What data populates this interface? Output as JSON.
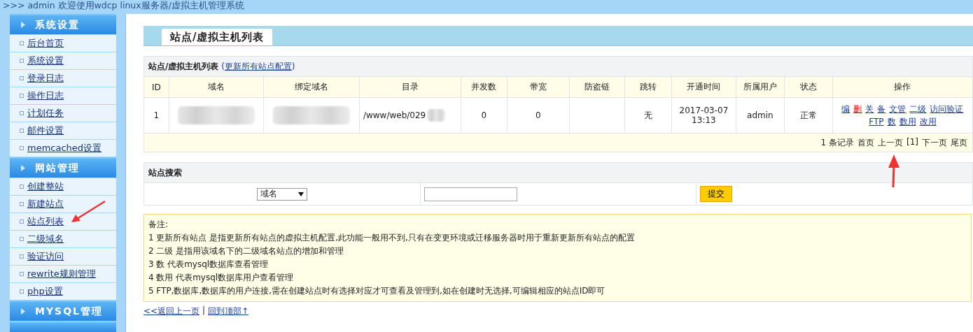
{
  "header": {
    "text": ">>> admin 欢迎使用wdcp linux服务器/虚拟主机管理系统"
  },
  "sidebar": {
    "sections": [
      {
        "title": "系统设置",
        "items": [
          {
            "label": "后台首页"
          },
          {
            "label": "系统设置"
          },
          {
            "label": "登录日志"
          },
          {
            "label": "操作日志"
          },
          {
            "label": "计划任务"
          },
          {
            "label": "邮件设置"
          },
          {
            "label": "memcached设置"
          }
        ]
      },
      {
        "title": "网站管理",
        "items": [
          {
            "label": "创建整站"
          },
          {
            "label": "新建站点"
          },
          {
            "label": "站点列表"
          },
          {
            "label": "二级域名"
          },
          {
            "label": "验证访问"
          },
          {
            "label": "rewrite规则管理"
          },
          {
            "label": "php设置"
          }
        ]
      },
      {
        "title": "MYSQL管理"
      }
    ]
  },
  "page_tab": {
    "label": "站点/虚拟主机列表"
  },
  "site_table": {
    "title": "站点/虚拟主机列表",
    "title_link": {
      "before": "(",
      "label": "更新所有站点配置",
      "after": ")"
    },
    "columns": [
      "ID",
      "域名",
      "绑定域名",
      "目录",
      "并发数",
      "带宽",
      "防盗链",
      "跳转",
      "开通时间",
      "所属用户",
      "状态",
      "操作"
    ],
    "rows": [
      {
        "cells": [
          {
            "kind": "text",
            "text": "1"
          },
          {
            "kind": "redacted"
          },
          {
            "kind": "redacted"
          },
          {
            "kind": "partial",
            "text": "/www/web/029"
          },
          {
            "kind": "text",
            "text": "0"
          },
          {
            "kind": "text",
            "text": "0"
          },
          {
            "kind": "text",
            "text": ""
          },
          {
            "kind": "text",
            "text": "无"
          },
          {
            "kind": "lines",
            "lines": [
              "2017-03-07",
              "13:13"
            ]
          },
          {
            "kind": "text",
            "text": "admin"
          },
          {
            "kind": "text",
            "text": "正常"
          },
          {
            "kind": "actions",
            "lines": [
              [
                {
                  "label": "编",
                  "kind": "link"
                },
                {
                  "label": "删",
                  "kind": "danger"
                },
                {
                  "label": "关",
                  "kind": "link"
                },
                {
                  "label": "备",
                  "kind": "link"
                },
                {
                  "label": "文管",
                  "kind": "link"
                },
                {
                  "label": "二级",
                  "kind": "link"
                },
                {
                  "label": "访问验证",
                  "kind": "link"
                }
              ],
              [
                {
                  "label": "FTP",
                  "kind": "link"
                },
                {
                  "label": "数",
                  "kind": "link"
                },
                {
                  "label": "数用",
                  "kind": "link"
                },
                {
                  "label": "改用",
                  "kind": "link"
                }
              ]
            ]
          }
        ]
      }
    ],
    "pager": {
      "count": "1 条记录",
      "links": [
        "首页",
        "上一页",
        "[1]",
        "下一页",
        "尾页"
      ]
    }
  },
  "search": {
    "title": "站点搜索",
    "select": {
      "value": "域名"
    },
    "button": "提交"
  },
  "notes": {
    "title": "备注:",
    "lines": [
      "1 更新所有站点 是指更新所有站点的虚拟主机配置,此功能一般用不到,只有在变更环境或迁移服务器时用于重新更新所有站点的配置",
      "2 二级 是指用该域名下的二级域名站点的增加和管理",
      "3 数 代表mysql数据库查看管理",
      "4 数用 代表mysql数据库用户查看管理",
      "5 FTP,数据库,数据库的用户连接,需在创建站点时有选择对应才可查看及管理到,如在创建时无选择,可编辑相应的站点ID即可"
    ]
  },
  "footer": {
    "links": [
      "<<返回上一页",
      "回到顶部↑"
    ],
    "separator": "|"
  }
}
